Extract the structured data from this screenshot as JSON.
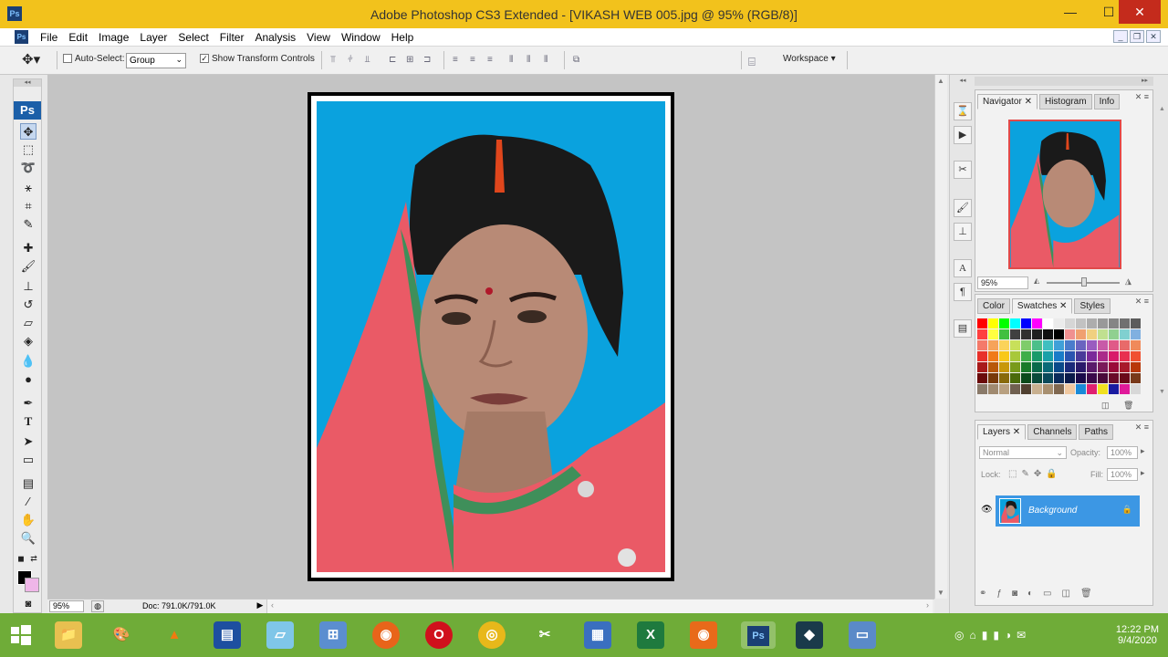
{
  "window": {
    "title": "Adobe Photoshop CS3 Extended - [VIKASH WEB 005.jpg @ 95% (RGB/8)]"
  },
  "menu": [
    "File",
    "Edit",
    "Image",
    "Layer",
    "Select",
    "Filter",
    "Analysis",
    "View",
    "Window",
    "Help"
  ],
  "options": {
    "auto_select_label": "Auto-Select:",
    "auto_select_value": "Group",
    "show_transform_label": "Show Transform Controls",
    "workspace_label": "Workspace"
  },
  "status": {
    "zoom": "95%",
    "doc": "Doc: 791.0K/791.0K"
  },
  "navigator": {
    "tabs": [
      "Navigator",
      "Histogram",
      "Info"
    ],
    "zoom": "95%"
  },
  "swatches": {
    "tabs": [
      "Color",
      "Swatches",
      "Styles"
    ]
  },
  "layers": {
    "tabs": [
      "Layers",
      "Channels",
      "Paths"
    ],
    "blend_mode": "Normal",
    "opacity_label": "Opacity:",
    "opacity_value": "100%",
    "lock_label": "Lock:",
    "fill_label": "Fill:",
    "fill_value": "100%",
    "layer_name": "Background"
  },
  "taskbar": {
    "time": "12:22 PM",
    "date": "9/4/2020"
  },
  "colors": {
    "titlebar": "#f2c21c",
    "taskbar": "#6fac38",
    "photo_bg": "#0aa2de",
    "layer_selected": "#3c97e4"
  }
}
